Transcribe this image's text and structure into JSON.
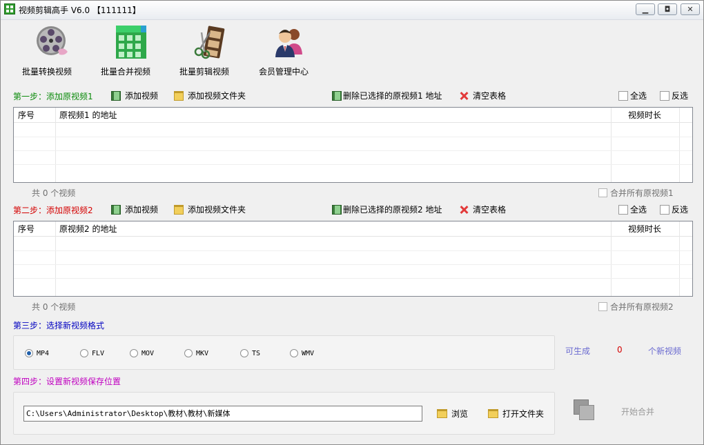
{
  "window": {
    "title": "视频剪辑高手 V6.0 【111111】",
    "controls": [
      "▁",
      "◘",
      "✕"
    ]
  },
  "toolbar": {
    "items": [
      {
        "label": "批量转换视频",
        "icon": "film-reel-icon"
      },
      {
        "label": "批量合并视频",
        "icon": "merge-grid-icon"
      },
      {
        "label": "批量剪辑视频",
        "icon": "film-scissors-icon"
      },
      {
        "label": "会员管理中心",
        "icon": "users-icon"
      }
    ]
  },
  "step1": {
    "label": "第一步：添加原视频1",
    "add_video": "添加视频",
    "add_folder": "添加视频文件夹",
    "delete_selected": "删除已选择的原视频1 地址",
    "clear_table": "清空表格",
    "select_all": "全选",
    "invert_select": "反选",
    "columns": [
      "序号",
      "原视频1 的地址",
      "视频时长"
    ],
    "count_text": "共 0 个视频",
    "merge_all": "合并所有原视频1"
  },
  "step2": {
    "label": "第二步：添加原视频2",
    "add_video": "添加视频",
    "add_folder": "添加视频文件夹",
    "delete_selected": "删除已选择的原视频2 地址",
    "clear_table": "清空表格",
    "select_all": "全选",
    "invert_select": "反选",
    "columns": [
      "序号",
      "原视频2 的地址",
      "视频时长"
    ],
    "count_text": "共 0 个视频",
    "merge_all": "合并所有原视频2"
  },
  "step3": {
    "label": "第三步：选择新视频格式",
    "formats": [
      "MP4",
      "FLV",
      "MOV",
      "MKV",
      "TS",
      "WMV"
    ],
    "selected": "MP4",
    "can_generate": "可生成",
    "count": "0",
    "new_videos": "个新视频"
  },
  "step4": {
    "label": "第四步：设置新视频保存位置",
    "path": "C:\\Users\\Administrator\\Desktop\\教材\\教材\\新媒体",
    "browse": "浏览",
    "open_folder": "打开文件夹",
    "start_merge": "开始合并"
  },
  "colors": {
    "step1": "#0a8a0a",
    "step2": "#d40000",
    "step3": "#0000c0",
    "step4": "#c000c0",
    "accent_link": "#6a6ad0",
    "count_red": "#d40000"
  }
}
